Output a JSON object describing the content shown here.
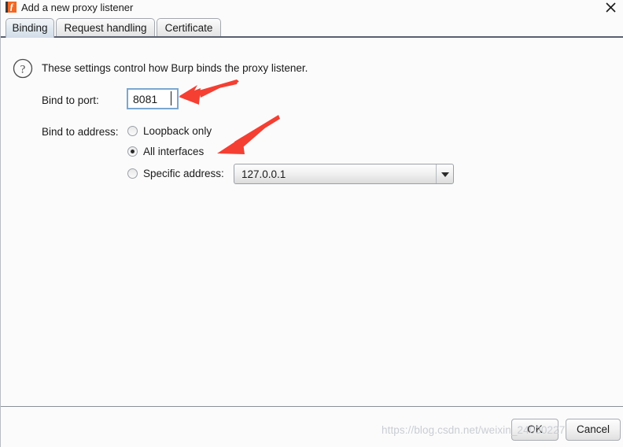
{
  "window": {
    "title": "Add a new proxy listener",
    "app_icon": "burp-suite-icon",
    "close_label": "✕"
  },
  "tabs": [
    {
      "label": "Binding",
      "selected": true
    },
    {
      "label": "Request handling",
      "selected": false
    },
    {
      "label": "Certificate",
      "selected": false
    }
  ],
  "binding": {
    "help_icon": "question-mark-icon",
    "intro": "These settings control how Burp binds the proxy listener.",
    "port": {
      "label": "Bind to port:",
      "value": "8081",
      "placeholder": ""
    },
    "address": {
      "label": "Bind to address:",
      "options": [
        {
          "label": "Loopback only",
          "selected": false
        },
        {
          "label": "All interfaces",
          "selected": true
        },
        {
          "label": "Specific address:",
          "selected": false
        }
      ],
      "specific_address_select": {
        "value": "127.0.0.1",
        "options": [
          "127.0.0.1"
        ],
        "arrow_icon": "chevron-down-icon"
      }
    }
  },
  "footer": {
    "ok_label": "OK",
    "cancel_label": "Cancel"
  },
  "watermark": {
    "text": "https://blog.csdn.net/weixin_24030227"
  },
  "annotations": {
    "arrow_color": "#f43f32",
    "arrows": [
      {
        "name": "arrow-to-port-input",
        "points_to": "port-input"
      },
      {
        "name": "arrow-to-all-interfaces",
        "points_to": "radio-all-interfaces"
      }
    ]
  },
  "colors": {
    "accent": "#f26724",
    "focus_border": "#7ba7d0",
    "tab_selected": "#d2dde8",
    "separator": "#8b8f99",
    "annotation": "#f43f32"
  }
}
